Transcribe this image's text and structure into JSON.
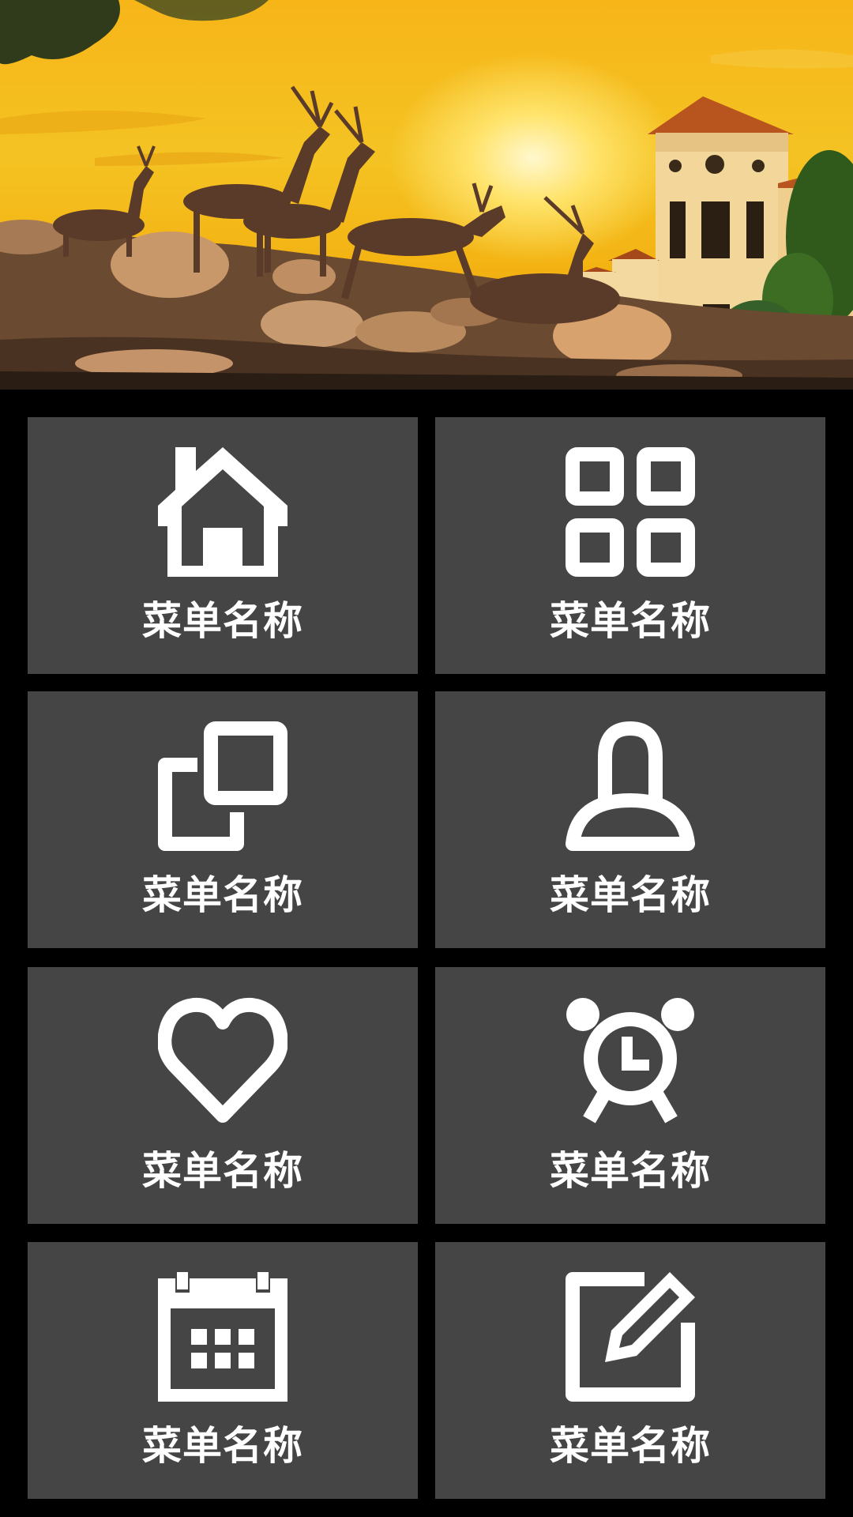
{
  "banner": {
    "image": "banner-photo: deer statues on rocks at sunset with a villa",
    "colors": {
      "sky_top": "#f7b518",
      "sun": "#fff8cf",
      "tile_bg": "#454545",
      "page_bg": "#000000"
    }
  },
  "menu": {
    "items": [
      {
        "label": "菜单名称",
        "icon": "home-icon"
      },
      {
        "label": "菜单名称",
        "icon": "grid-icon"
      },
      {
        "label": "菜单名称",
        "icon": "copy-icon"
      },
      {
        "label": "菜单名称",
        "icon": "user-icon"
      },
      {
        "label": "菜单名称",
        "icon": "heart-icon"
      },
      {
        "label": "菜单名称",
        "icon": "alarm-clock-icon"
      },
      {
        "label": "菜单名称",
        "icon": "calendar-icon"
      },
      {
        "label": "菜单名称",
        "icon": "edit-icon"
      }
    ]
  }
}
